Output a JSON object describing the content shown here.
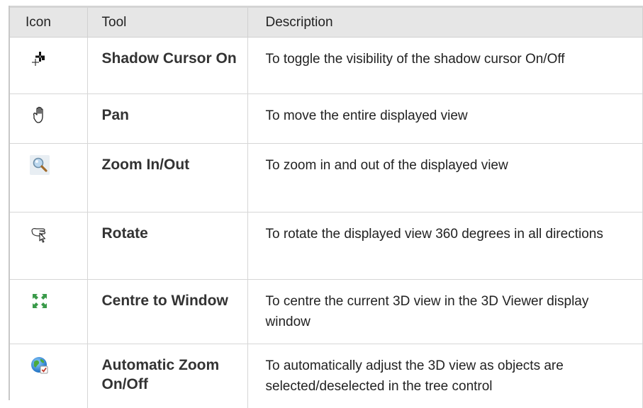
{
  "table": {
    "headers": {
      "icon": "Icon",
      "tool": "Tool",
      "description": "Description"
    },
    "rows": [
      {
        "icon": "shadow-cursor-icon",
        "tool": "Shadow Cursor On",
        "description": "To toggle the visibility of the shadow cursor On/Off"
      },
      {
        "icon": "hand-pan-icon",
        "tool": "Pan",
        "description": "To move the entire displayed view"
      },
      {
        "icon": "magnifier-zoom-icon",
        "tool": "Zoom In/Out",
        "description": "To zoom in and out of the displayed view"
      },
      {
        "icon": "rotate-hand-icon",
        "tool": "Rotate",
        "description": "To rotate the displayed view 360 degrees in all directions"
      },
      {
        "icon": "centre-arrows-icon",
        "tool": "Centre to Window",
        "description": "To centre the current 3D view in the 3D Viewer display window"
      },
      {
        "icon": "globe-auto-zoom-icon",
        "tool": "Automatic Zoom On/Off",
        "description": "To automatically adjust the 3D view as objects are selected/deselected in the tree control"
      }
    ]
  },
  "colors": {
    "header_bg": "#e6e6e6",
    "border": "#d6d6d6",
    "text": "#222222",
    "arrow_green": "#3a9a4a",
    "globe_blue": "#2a7fd0"
  }
}
